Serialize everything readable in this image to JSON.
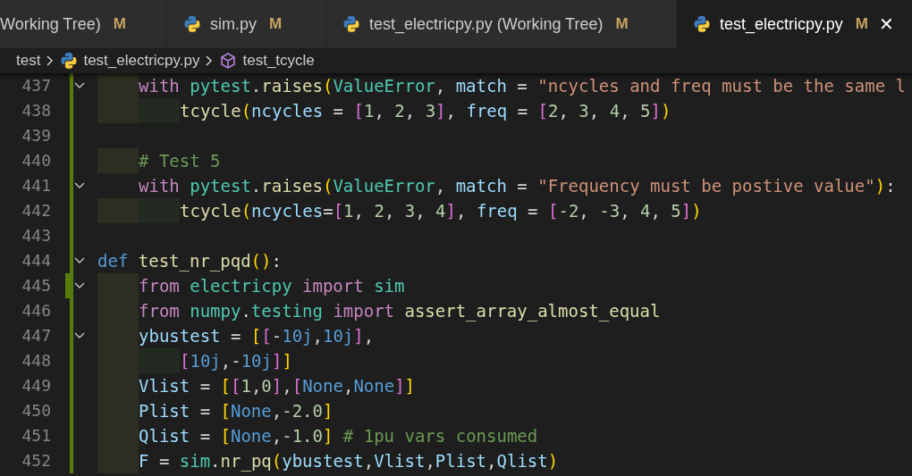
{
  "tabs": [
    {
      "label": "Working Tree)",
      "badge": "M",
      "selected": false
    },
    {
      "label": "sim.py",
      "badge": "M",
      "selected": false
    },
    {
      "label": "test_electricpy.py (Working Tree)",
      "badge": "M",
      "selected": false
    },
    {
      "label": "test_electricpy.py",
      "badge": "M",
      "selected": true,
      "close": "✕"
    }
  ],
  "breadcrumb": [
    {
      "label": "test"
    },
    {
      "label": "test_electricpy.py"
    },
    {
      "label": "test_tcycle"
    }
  ],
  "lines": [
    {
      "number": "437",
      "fold": true,
      "kind": "added",
      "indent": [
        {
          "kind": "outer"
        }
      ],
      "tokens": [
        {
          "kind": "kw",
          "text": "with "
        },
        {
          "kind": "cls",
          "text": "pytest"
        },
        {
          "kind": "op",
          "text": "."
        },
        {
          "kind": "fn",
          "text": "raises"
        },
        {
          "kind": "b1",
          "text": "("
        },
        {
          "kind": "cls",
          "text": "ValueError"
        },
        {
          "kind": "op",
          "text": ", "
        },
        {
          "kind": "var",
          "text": "match"
        },
        {
          "kind": "op",
          "text": " = "
        },
        {
          "kind": "str",
          "text": "\"ncycles and freq must be the same l"
        }
      ]
    },
    {
      "number": "438",
      "fold": false,
      "kind": "added",
      "indent": [
        {
          "kind": "outer"
        },
        {
          "kind": "inner"
        }
      ],
      "tokens": [
        {
          "kind": "fn",
          "text": "tcycle"
        },
        {
          "kind": "b1",
          "text": "("
        },
        {
          "kind": "var",
          "text": "ncycles"
        },
        {
          "kind": "op",
          "text": " = "
        },
        {
          "kind": "b2",
          "text": "["
        },
        {
          "kind": "num",
          "text": "1"
        },
        {
          "kind": "op",
          "text": ", "
        },
        {
          "kind": "num",
          "text": "2"
        },
        {
          "kind": "op",
          "text": ", "
        },
        {
          "kind": "num",
          "text": "3"
        },
        {
          "kind": "b2",
          "text": "]"
        },
        {
          "kind": "op",
          "text": ", "
        },
        {
          "kind": "var",
          "text": "freq"
        },
        {
          "kind": "op",
          "text": " = "
        },
        {
          "kind": "b2",
          "text": "["
        },
        {
          "kind": "num",
          "text": "2"
        },
        {
          "kind": "op",
          "text": ", "
        },
        {
          "kind": "num",
          "text": "3"
        },
        {
          "kind": "op",
          "text": ", "
        },
        {
          "kind": "num",
          "text": "4"
        },
        {
          "kind": "op",
          "text": ", "
        },
        {
          "kind": "num",
          "text": "5"
        },
        {
          "kind": "b2",
          "text": "]"
        },
        {
          "kind": "b1",
          "text": ")"
        }
      ]
    },
    {
      "number": "439",
      "fold": false,
      "kind": "added"
    },
    {
      "number": "440",
      "fold": false,
      "kind": "added",
      "indent": [
        {
          "kind": "outer"
        }
      ],
      "tokens": [
        {
          "kind": "com",
          "text": "# Test 5"
        }
      ]
    },
    {
      "number": "441",
      "fold": true,
      "kind": "added",
      "indent": [
        {
          "kind": "blank"
        }
      ],
      "tokens": [
        {
          "kind": "kw",
          "text": "with "
        },
        {
          "kind": "cls",
          "text": "pytest"
        },
        {
          "kind": "op",
          "text": "."
        },
        {
          "kind": "fn",
          "text": "raises"
        },
        {
          "kind": "b1",
          "text": "("
        },
        {
          "kind": "cls",
          "text": "ValueError"
        },
        {
          "kind": "op",
          "text": ", "
        },
        {
          "kind": "var",
          "text": "match"
        },
        {
          "kind": "op",
          "text": " = "
        },
        {
          "kind": "str",
          "text": "\"Frequency must be postive value\""
        },
        {
          "kind": "b1",
          "text": ")"
        },
        {
          "kind": "op",
          "text": ":"
        }
      ]
    },
    {
      "number": "442",
      "fold": false,
      "kind": "added",
      "indent": [
        {
          "kind": "outer"
        },
        {
          "kind": "inner"
        }
      ],
      "tokens": [
        {
          "kind": "fn",
          "text": "tcycle"
        },
        {
          "kind": "b1",
          "text": "("
        },
        {
          "kind": "var",
          "text": "ncycles"
        },
        {
          "kind": "op",
          "text": "="
        },
        {
          "kind": "b2",
          "text": "["
        },
        {
          "kind": "num",
          "text": "1"
        },
        {
          "kind": "op",
          "text": ", "
        },
        {
          "kind": "num",
          "text": "2"
        },
        {
          "kind": "op",
          "text": ", "
        },
        {
          "kind": "num",
          "text": "3"
        },
        {
          "kind": "op",
          "text": ", "
        },
        {
          "kind": "num",
          "text": "4"
        },
        {
          "kind": "b2",
          "text": "]"
        },
        {
          "kind": "op",
          "text": ", "
        },
        {
          "kind": "var",
          "text": "freq"
        },
        {
          "kind": "op",
          "text": " = "
        },
        {
          "kind": "b2",
          "text": "["
        },
        {
          "kind": "num",
          "text": "-2"
        },
        {
          "kind": "op",
          "text": ", "
        },
        {
          "kind": "num",
          "text": "-3"
        },
        {
          "kind": "op",
          "text": ", "
        },
        {
          "kind": "num",
          "text": "4"
        },
        {
          "kind": "op",
          "text": ", "
        },
        {
          "kind": "num",
          "text": "5"
        },
        {
          "kind": "b2",
          "text": "]"
        },
        {
          "kind": "b1",
          "text": ")"
        }
      ]
    },
    {
      "number": "443",
      "fold": false,
      "kind": "added"
    },
    {
      "number": "444",
      "fold": true,
      "kind": "added",
      "tokens": [
        {
          "kind": "def",
          "text": "def "
        },
        {
          "kind": "fn",
          "text": "test_nr_pqd"
        },
        {
          "kind": "b1",
          "text": "()"
        },
        {
          "kind": "op",
          "text": ":"
        }
      ]
    },
    {
      "number": "445",
      "fold": true,
      "kind": "modified",
      "indent": [
        {
          "kind": "outer"
        }
      ],
      "tokens": [
        {
          "kind": "kw",
          "text": "from "
        },
        {
          "kind": "cls",
          "text": "electricpy "
        },
        {
          "kind": "kw",
          "text": "import "
        },
        {
          "kind": "cls",
          "text": "sim"
        }
      ]
    },
    {
      "number": "446",
      "fold": false,
      "kind": "added",
      "indent": [
        {
          "kind": "outer"
        }
      ],
      "tokens": [
        {
          "kind": "kw",
          "text": "from "
        },
        {
          "kind": "cls",
          "text": "numpy"
        },
        {
          "kind": "op",
          "text": "."
        },
        {
          "kind": "cls",
          "text": "testing "
        },
        {
          "kind": "kw",
          "text": "import "
        },
        {
          "kind": "fn",
          "text": "assert_array_almost_equal"
        }
      ]
    },
    {
      "number": "447",
      "fold": true,
      "kind": "added",
      "indent": [
        {
          "kind": "outer"
        }
      ],
      "tokens": [
        {
          "kind": "var",
          "text": "ybustest"
        },
        {
          "kind": "op",
          "text": " = "
        },
        {
          "kind": "b1",
          "text": "["
        },
        {
          "kind": "b2",
          "text": "["
        },
        {
          "kind": "op",
          "text": "-"
        },
        {
          "kind": "const",
          "text": "10j"
        },
        {
          "kind": "op",
          "text": ","
        },
        {
          "kind": "const",
          "text": "10j"
        },
        {
          "kind": "b2",
          "text": "]"
        },
        {
          "kind": "op",
          "text": ","
        }
      ]
    },
    {
      "number": "448",
      "fold": false,
      "kind": "added",
      "indent": [
        {
          "kind": "outer"
        },
        {
          "kind": "inner"
        }
      ],
      "tokens": [
        {
          "kind": "b2",
          "text": "["
        },
        {
          "kind": "const",
          "text": "10j"
        },
        {
          "kind": "op",
          "text": ",-"
        },
        {
          "kind": "const",
          "text": "10j"
        },
        {
          "kind": "b2",
          "text": "]"
        },
        {
          "kind": "b1",
          "text": "]"
        }
      ]
    },
    {
      "number": "449",
      "fold": false,
      "kind": "added",
      "indent": [
        {
          "kind": "outer"
        }
      ],
      "tokens": [
        {
          "kind": "var",
          "text": "Vlist"
        },
        {
          "kind": "op",
          "text": " = "
        },
        {
          "kind": "b1",
          "text": "["
        },
        {
          "kind": "b2",
          "text": "["
        },
        {
          "kind": "num",
          "text": "1"
        },
        {
          "kind": "op",
          "text": ","
        },
        {
          "kind": "num",
          "text": "0"
        },
        {
          "kind": "b2",
          "text": "]"
        },
        {
          "kind": "op",
          "text": ","
        },
        {
          "kind": "b2",
          "text": "["
        },
        {
          "kind": "const",
          "text": "None"
        },
        {
          "kind": "op",
          "text": ","
        },
        {
          "kind": "const",
          "text": "None"
        },
        {
          "kind": "b2",
          "text": "]"
        },
        {
          "kind": "b1",
          "text": "]"
        }
      ]
    },
    {
      "number": "450",
      "fold": false,
      "kind": "added",
      "indent": [
        {
          "kind": "outer"
        }
      ],
      "tokens": [
        {
          "kind": "var",
          "text": "Plist"
        },
        {
          "kind": "op",
          "text": " = "
        },
        {
          "kind": "b1",
          "text": "["
        },
        {
          "kind": "const",
          "text": "None"
        },
        {
          "kind": "op",
          "text": ","
        },
        {
          "kind": "num",
          "text": "-2.0"
        },
        {
          "kind": "b1",
          "text": "]"
        }
      ]
    },
    {
      "number": "451",
      "fold": false,
      "kind": "added",
      "indent": [
        {
          "kind": "outer"
        }
      ],
      "tokens": [
        {
          "kind": "var",
          "text": "Qlist"
        },
        {
          "kind": "op",
          "text": " = "
        },
        {
          "kind": "b1",
          "text": "["
        },
        {
          "kind": "const",
          "text": "None"
        },
        {
          "kind": "op",
          "text": ","
        },
        {
          "kind": "num",
          "text": "-1.0"
        },
        {
          "kind": "b1",
          "text": "] "
        },
        {
          "kind": "com",
          "text": "# 1pu vars consumed"
        }
      ]
    },
    {
      "number": "452",
      "fold": false,
      "kind": "added",
      "indent": [
        {
          "kind": "outer"
        }
      ],
      "tokens": [
        {
          "kind": "var",
          "text": "F"
        },
        {
          "kind": "op",
          "text": " = "
        },
        {
          "kind": "cls",
          "text": "sim"
        },
        {
          "kind": "op",
          "text": "."
        },
        {
          "kind": "fn",
          "text": "nr_pq"
        },
        {
          "kind": "b1",
          "text": "("
        },
        {
          "kind": "var",
          "text": "ybustest"
        },
        {
          "kind": "op",
          "text": ","
        },
        {
          "kind": "var",
          "text": "Vlist"
        },
        {
          "kind": "op",
          "text": ","
        },
        {
          "kind": "var",
          "text": "Plist"
        },
        {
          "kind": "op",
          "text": ","
        },
        {
          "kind": "var",
          "text": "Qlist"
        },
        {
          "kind": "b1",
          "text": ")"
        }
      ]
    }
  ]
}
